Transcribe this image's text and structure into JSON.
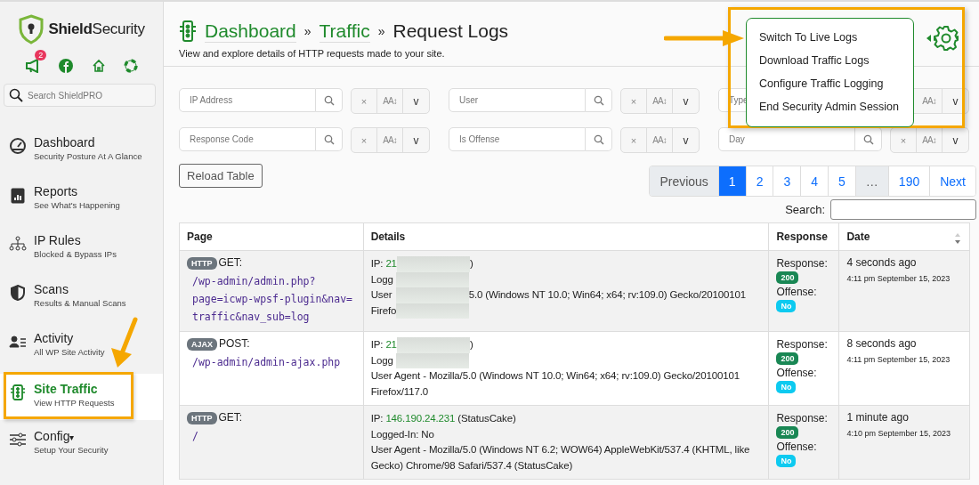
{
  "brand": {
    "bold": "Shield",
    "rest": "Security"
  },
  "notifications": {
    "count": "2"
  },
  "sidebar_search": {
    "placeholder": "Search ShieldPRO"
  },
  "nav": [
    {
      "title": "Dashboard",
      "subtitle": "Security Posture At A Glance",
      "selected": false
    },
    {
      "title": "Reports",
      "subtitle": "See What's Happening",
      "selected": false
    },
    {
      "title": "IP Rules",
      "subtitle": "Blocked & Bypass IPs",
      "selected": false
    },
    {
      "title": "Scans",
      "subtitle": "Results & Manual Scans",
      "selected": false
    },
    {
      "title": "Activity",
      "subtitle": "All WP Site Activity",
      "selected": false
    },
    {
      "title": "Site Traffic",
      "subtitle": "View HTTP Requests",
      "selected": true
    },
    {
      "title": "Config",
      "subtitle": "Setup Your Security",
      "selected": false,
      "caret": "▾"
    }
  ],
  "breadcrumb": {
    "links": [
      "Dashboard",
      "Traffic"
    ],
    "separator": "»",
    "current": "Request Logs"
  },
  "subtitle": "View and explore details of HTTP requests made to your site.",
  "settings_menu": {
    "items": [
      "Switch To Live Logs",
      "Download Traffic Logs",
      "Configure Traffic Logging",
      "End Security Admin Session"
    ]
  },
  "filters": [
    {
      "placeholder": "IP Address",
      "clear": "×",
      "case": "AA↕",
      "toggle": "v"
    },
    {
      "placeholder": "User",
      "clear": "×",
      "case": "AA↕",
      "toggle": "v"
    },
    {
      "placeholder": "Type",
      "case": "AA↕",
      "toggle": "v"
    },
    {
      "placeholder": "Response Code",
      "clear": "×",
      "case": "AA↕",
      "toggle": "v"
    },
    {
      "placeholder": "Is Offense",
      "clear": "×",
      "case": "AA↕",
      "toggle": "v"
    },
    {
      "placeholder": "Day",
      "clear": "×",
      "case": "AA↕",
      "toggle": "v"
    }
  ],
  "reload_button": "Reload Table",
  "pagination": [
    {
      "label": "Previous",
      "selected": false,
      "disabled": true
    },
    {
      "label": "1",
      "selected": true,
      "disabled": false
    },
    {
      "label": "2",
      "selected": false,
      "disabled": false
    },
    {
      "label": "3",
      "selected": false,
      "disabled": false
    },
    {
      "label": "4",
      "selected": false,
      "disabled": false
    },
    {
      "label": "5",
      "selected": false,
      "disabled": false
    },
    {
      "label": "…",
      "selected": false,
      "disabled": true
    },
    {
      "label": "190",
      "selected": false,
      "disabled": false
    },
    {
      "label": "Next",
      "selected": false,
      "disabled": false
    }
  ],
  "table_search": {
    "label": "Search:"
  },
  "table": {
    "columns": [
      "Page",
      "Details",
      "Response",
      "Date"
    ],
    "rows": [
      {
        "type": "HTTP",
        "method": "GET:",
        "path": [
          "/wp-admin/admin.php?",
          "page=icwp-wpsf-plugin&nav=",
          "traffic&nav_sub=log"
        ],
        "details": [
          {
            "pre": "IP: ",
            "ip": "21",
            "post": ")",
            "redacted": true
          },
          {
            "pre": "Logg",
            "redacted": true
          },
          {
            "pre": "User",
            "post": "5.0 (Windows NT 10.0; Win64; x64; rv:109.0) Gecko/20100101",
            "redacted": true
          },
          {
            "pre": "Firefo",
            "redacted": true
          }
        ],
        "response_label": "Response:",
        "code": "200",
        "offense_label": "Offense:",
        "offense": "No",
        "ago": "4 seconds ago",
        "date": "4:11 pm September 15, 2023"
      },
      {
        "type": "AJAX",
        "method": "POST:",
        "path": [
          "/wp-admin/admin-ajax.php"
        ],
        "details": [
          {
            "pre": "IP: ",
            "ip": "21",
            "post": ")",
            "redacted": true
          },
          {
            "pre": "Logg",
            "redacted": true
          },
          {
            "pre": "User Agent - Mozilla/5.0 (Windows NT 10.0; Win64; x64; rv:109.0) Gecko/20100101",
            "redacted": false
          },
          {
            "pre": "Firefox/117.0",
            "redacted": false
          }
        ],
        "response_label": "Response:",
        "code": "200",
        "offense_label": "Offense:",
        "offense": "No",
        "ago": "8 seconds ago",
        "date": "4:11 pm September 15, 2023"
      },
      {
        "type": "HTTP",
        "method": "GET:",
        "path": [
          "/"
        ],
        "details": [
          {
            "pre": "IP: ",
            "ip": "146.190.24.231",
            "post": " (StatusCake)",
            "redacted": false
          },
          {
            "pre": "Logged-In: No",
            "redacted": false
          },
          {
            "pre": "User Agent - Mozilla/5.0 (Windows NT 6.2; WOW64) AppleWebKit/537.4 (KHTML, like Gecko) Chrome/98 Safari/537.4 (StatusCake)",
            "redacted": false
          }
        ],
        "response_label": "Response:",
        "code": "200",
        "offense_label": "Offense:",
        "offense": "No",
        "ago": "1 minute ago",
        "date": "4:10 pm September 15, 2023"
      }
    ]
  }
}
